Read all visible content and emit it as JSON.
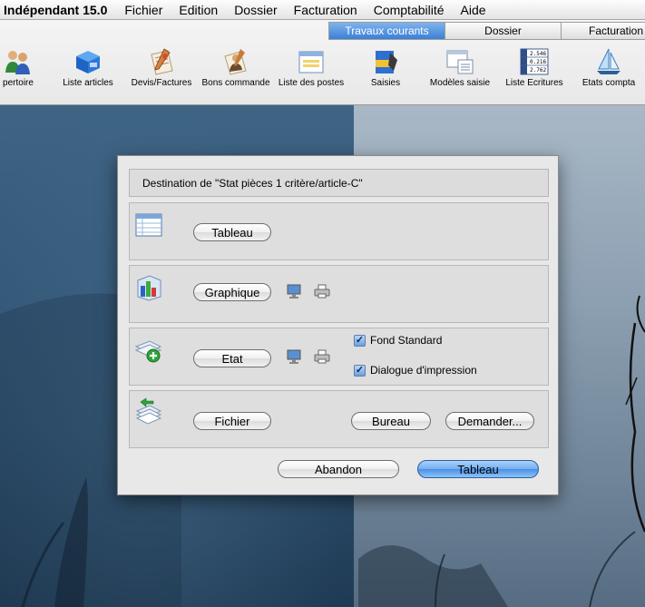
{
  "menubar": {
    "app_name": "Indépendant 15.0",
    "items": [
      "Fichier",
      "Edition",
      "Dossier",
      "Facturation",
      "Comptabilité",
      "Aide"
    ]
  },
  "tabs": [
    {
      "label": "Travaux courants",
      "active": true
    },
    {
      "label": "Dossier",
      "active": false
    },
    {
      "label": "Facturation",
      "active": false
    }
  ],
  "toolbar": {
    "items": [
      {
        "label": "pertoire",
        "icon": "people-icon"
      },
      {
        "label": "Liste articles",
        "icon": "box-icon"
      },
      {
        "label": "Devis/Factures",
        "icon": "document-pen-icon"
      },
      {
        "label": "Bons commande",
        "icon": "order-form-icon"
      },
      {
        "label": "Liste des postes",
        "icon": "window-list-icon"
      },
      {
        "label": "Saisies",
        "icon": "data-entry-icon"
      },
      {
        "label": "Modèles saisie",
        "icon": "templates-icon"
      },
      {
        "label": "Liste Ecritures",
        "icon": "ledger-icon"
      },
      {
        "label": "Etats compta",
        "icon": "sailboat-icon"
      }
    ],
    "ledger_values": [
      "2.546",
      "0.216",
      "2.762"
    ]
  },
  "dialog": {
    "title": "Destination de \"Stat pièces 1 critère/article-C\"",
    "tableau_label": "Tableau",
    "graphique_label": "Graphique",
    "etat_label": "Etat",
    "fond_standard_label": "Fond Standard",
    "fond_standard_checked": true,
    "dialogue_impression_label": "Dialogue d'impression",
    "dialogue_impression_checked": true,
    "fichier_label": "Fichier",
    "bureau_label": "Bureau",
    "demander_label": "Demander...",
    "abandon_label": "Abandon",
    "ok_label": "Tableau"
  },
  "colors": {
    "accent": "#4b8fe3",
    "tab_active": "#3b80d6"
  }
}
